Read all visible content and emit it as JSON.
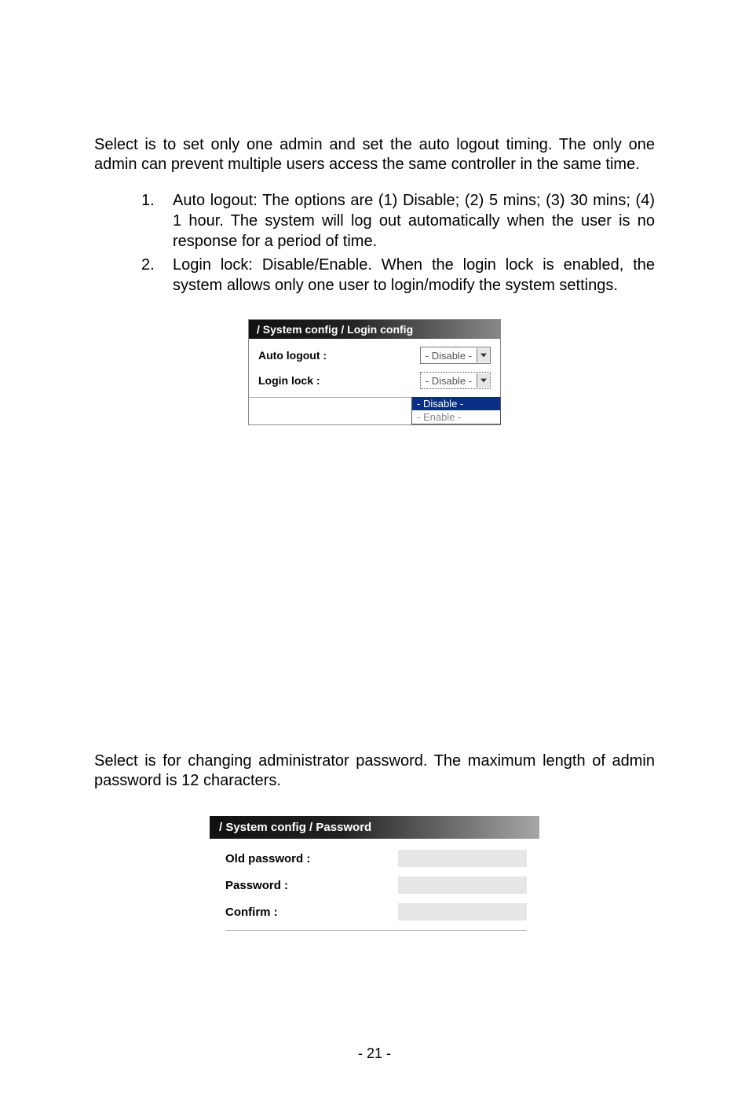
{
  "section1": {
    "para": "Select                            is to set only one admin and set the auto logout timing. The only one admin can prevent multiple users access the same controller in the same time.",
    "list": [
      {
        "num": "1.",
        "text": "Auto logout: The options are (1) Disable; (2) 5 mins; (3) 30 mins; (4) 1 hour. The system will log out automatically when the user is no response for a period of time."
      },
      {
        "num": "2.",
        "text": "Login lock: Disable/Enable. When the login lock is enabled, the system allows only one user to login/modify the system settings."
      }
    ]
  },
  "loginConfigPanel": {
    "title": "/ System config / Login config",
    "rows": {
      "autoLogout": {
        "label": "Auto logout :",
        "value": "- Disable -"
      },
      "loginLock": {
        "label": "Login lock :",
        "value": "- Disable -"
      }
    },
    "dropdown": {
      "selected": "- Disable -",
      "other": "- Enable -"
    }
  },
  "section2": {
    "para": "Select                       is for changing administrator password. The maximum length of admin password is 12 characters."
  },
  "passwordPanel": {
    "title": "/ System config / Password",
    "rows": {
      "old": {
        "label": "Old password :"
      },
      "new": {
        "label": "Password :"
      },
      "confirm": {
        "label": "Confirm :"
      }
    }
  },
  "pageNumber": "- 21 -"
}
